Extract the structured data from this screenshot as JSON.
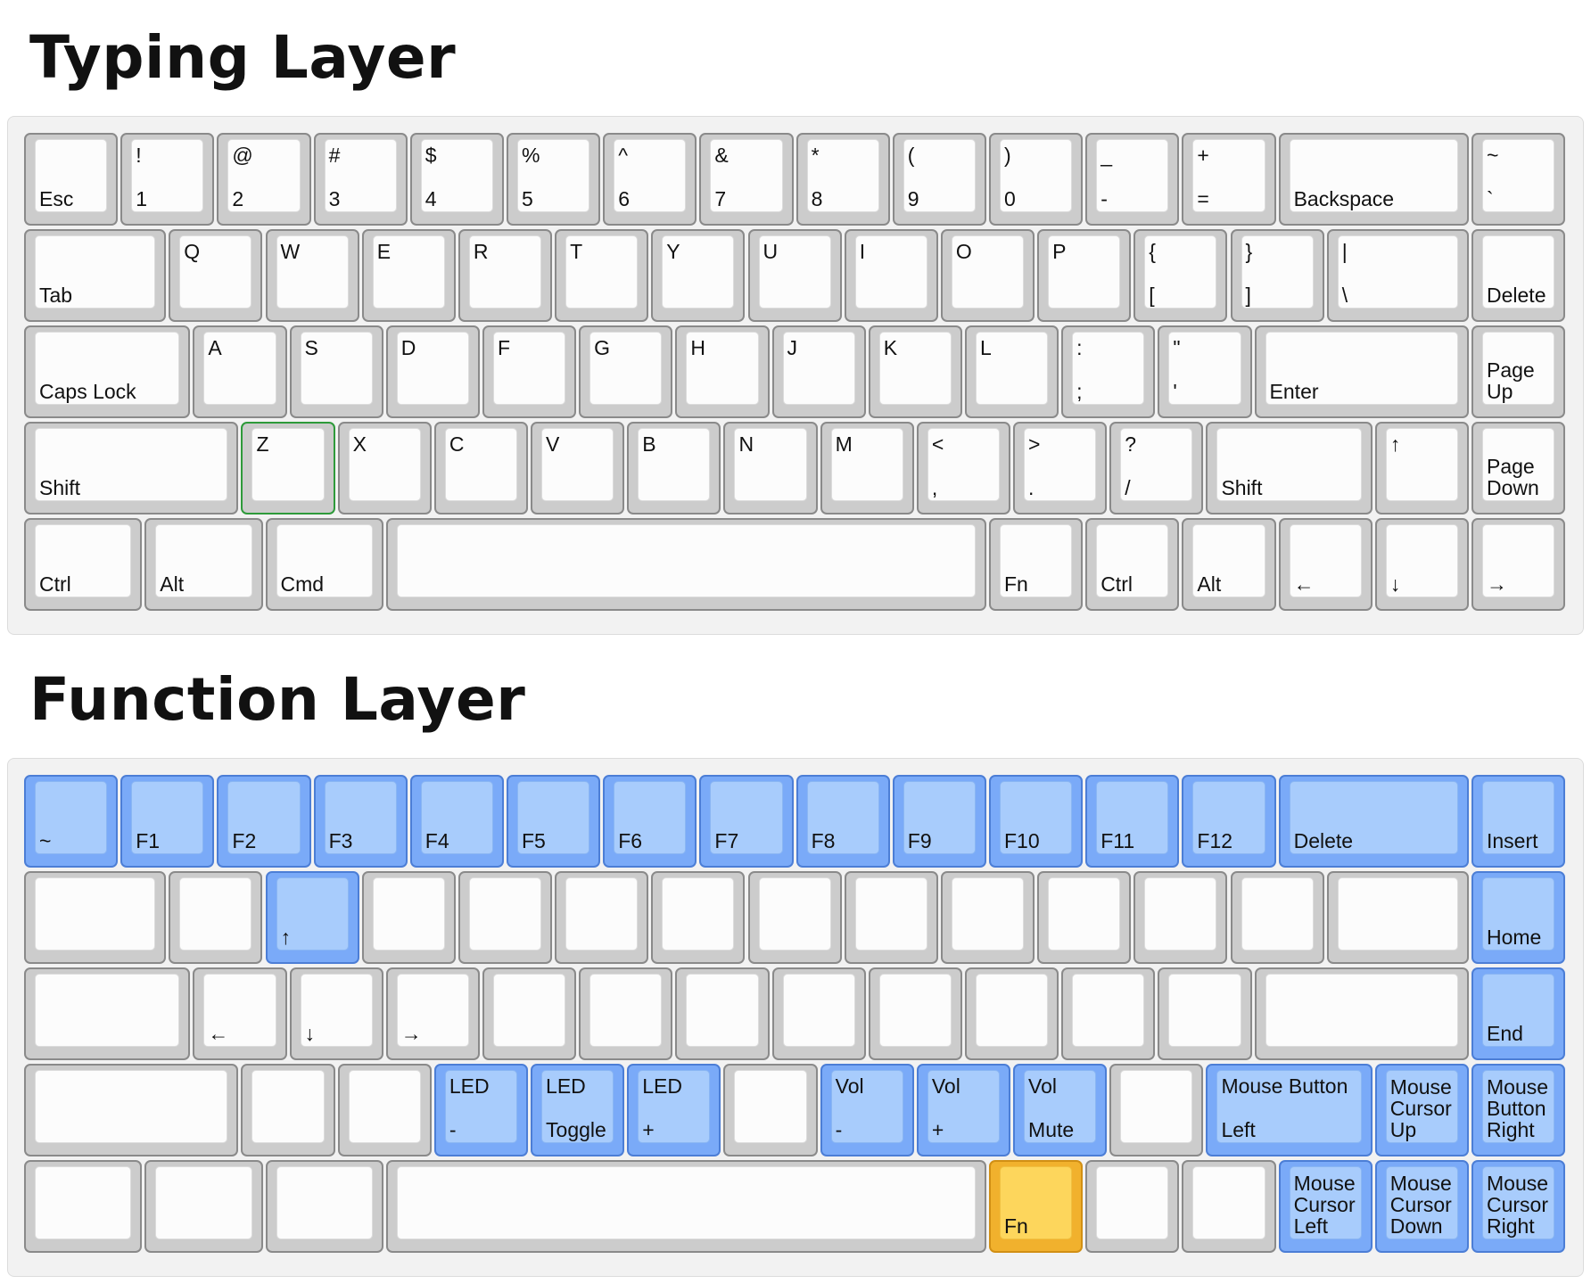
{
  "typing_layer": {
    "title": "Typing Layer",
    "rows": [
      [
        {
          "w": 1,
          "bottom": "Esc"
        },
        {
          "w": 1,
          "top": "!",
          "bottom": "1"
        },
        {
          "w": 1,
          "top": "@",
          "bottom": "2"
        },
        {
          "w": 1,
          "top": "#",
          "bottom": "3"
        },
        {
          "w": 1,
          "top": "$",
          "bottom": "4"
        },
        {
          "w": 1,
          "top": "%",
          "bottom": "5"
        },
        {
          "w": 1,
          "top": "^",
          "bottom": "6"
        },
        {
          "w": 1,
          "top": "&",
          "bottom": "7"
        },
        {
          "w": 1,
          "top": "*",
          "bottom": "8"
        },
        {
          "w": 1,
          "top": "(",
          "bottom": "9"
        },
        {
          "w": 1,
          "top": ")",
          "bottom": "0"
        },
        {
          "w": 1,
          "top": "_",
          "bottom": "-"
        },
        {
          "w": 1,
          "top": "+",
          "bottom": "="
        },
        {
          "w": 2,
          "bottom": "Backspace"
        },
        {
          "w": 1,
          "top": "~",
          "bottom": "`"
        }
      ],
      [
        {
          "w": 1.5,
          "bottom": "Tab"
        },
        {
          "w": 1,
          "top": "Q"
        },
        {
          "w": 1,
          "top": "W"
        },
        {
          "w": 1,
          "top": "E"
        },
        {
          "w": 1,
          "top": "R"
        },
        {
          "w": 1,
          "top": "T"
        },
        {
          "w": 1,
          "top": "Y"
        },
        {
          "w": 1,
          "top": "U"
        },
        {
          "w": 1,
          "top": "I"
        },
        {
          "w": 1,
          "top": "O"
        },
        {
          "w": 1,
          "top": "P"
        },
        {
          "w": 1,
          "top": "{",
          "bottom": "["
        },
        {
          "w": 1,
          "top": "}",
          "bottom": "]"
        },
        {
          "w": 1.5,
          "top": "|",
          "bottom": "\\"
        },
        {
          "w": 1,
          "bottom": "Delete"
        }
      ],
      [
        {
          "w": 1.75,
          "bottom": "Caps Lock"
        },
        {
          "w": 1,
          "top": "A"
        },
        {
          "w": 1,
          "top": "S"
        },
        {
          "w": 1,
          "top": "D"
        },
        {
          "w": 1,
          "top": "F"
        },
        {
          "w": 1,
          "top": "G"
        },
        {
          "w": 1,
          "top": "H"
        },
        {
          "w": 1,
          "top": "J"
        },
        {
          "w": 1,
          "top": "K"
        },
        {
          "w": 1,
          "top": "L"
        },
        {
          "w": 1,
          "top": ":",
          "bottom": ";"
        },
        {
          "w": 1,
          "top": "\"",
          "bottom": "'"
        },
        {
          "w": 2.25,
          "bottom": "Enter"
        },
        {
          "w": 1,
          "bottom": "Page\nUp"
        }
      ],
      [
        {
          "w": 2.25,
          "bottom": "Shift"
        },
        {
          "w": 1,
          "top": "Z",
          "highlight": "green"
        },
        {
          "w": 1,
          "top": "X"
        },
        {
          "w": 1,
          "top": "C"
        },
        {
          "w": 1,
          "top": "V"
        },
        {
          "w": 1,
          "top": "B"
        },
        {
          "w": 1,
          "top": "N"
        },
        {
          "w": 1,
          "top": "M"
        },
        {
          "w": 1,
          "top": "<",
          "bottom": ","
        },
        {
          "w": 1,
          "top": ">",
          "bottom": "."
        },
        {
          "w": 1,
          "top": "?",
          "bottom": "/"
        },
        {
          "w": 1.75,
          "bottom": "Shift"
        },
        {
          "w": 1,
          "top": "↑"
        },
        {
          "w": 1,
          "bottom": "Page\nDown"
        }
      ],
      [
        {
          "w": 1.25,
          "bottom": "Ctrl"
        },
        {
          "w": 1.25,
          "bottom": "Alt"
        },
        {
          "w": 1.25,
          "bottom": "Cmd"
        },
        {
          "w": 6.25,
          "bottom": ""
        },
        {
          "w": 1,
          "bottom": "Fn"
        },
        {
          "w": 1,
          "bottom": "Ctrl"
        },
        {
          "w": 1,
          "bottom": "Alt"
        },
        {
          "w": 1,
          "bottom": "←"
        },
        {
          "w": 1,
          "bottom": "↓"
        },
        {
          "w": 1,
          "bottom": "→"
        }
      ]
    ]
  },
  "function_layer": {
    "title": "Function Layer",
    "rows": [
      [
        {
          "w": 1,
          "bottom": "~",
          "highlight": "blue"
        },
        {
          "w": 1,
          "bottom": "F1",
          "highlight": "blue"
        },
        {
          "w": 1,
          "bottom": "F2",
          "highlight": "blue"
        },
        {
          "w": 1,
          "bottom": "F3",
          "highlight": "blue"
        },
        {
          "w": 1,
          "bottom": "F4",
          "highlight": "blue"
        },
        {
          "w": 1,
          "bottom": "F5",
          "highlight": "blue"
        },
        {
          "w": 1,
          "bottom": "F6",
          "highlight": "blue"
        },
        {
          "w": 1,
          "bottom": "F7",
          "highlight": "blue"
        },
        {
          "w": 1,
          "bottom": "F8",
          "highlight": "blue"
        },
        {
          "w": 1,
          "bottom": "F9",
          "highlight": "blue"
        },
        {
          "w": 1,
          "bottom": "F10",
          "highlight": "blue"
        },
        {
          "w": 1,
          "bottom": "F11",
          "highlight": "blue"
        },
        {
          "w": 1,
          "bottom": "F12",
          "highlight": "blue"
        },
        {
          "w": 2,
          "bottom": "Delete",
          "highlight": "blue"
        },
        {
          "w": 1,
          "bottom": "Insert",
          "highlight": "blue"
        }
      ],
      [
        {
          "w": 1.5
        },
        {
          "w": 1
        },
        {
          "w": 1,
          "bottom": "↑",
          "highlight": "blue"
        },
        {
          "w": 1
        },
        {
          "w": 1
        },
        {
          "w": 1
        },
        {
          "w": 1
        },
        {
          "w": 1
        },
        {
          "w": 1
        },
        {
          "w": 1
        },
        {
          "w": 1
        },
        {
          "w": 1
        },
        {
          "w": 1
        },
        {
          "w": 1.5
        },
        {
          "w": 1,
          "bottom": "Home",
          "highlight": "blue"
        }
      ],
      [
        {
          "w": 1.75
        },
        {
          "w": 1,
          "bottom": "←"
        },
        {
          "w": 1,
          "bottom": "↓"
        },
        {
          "w": 1,
          "bottom": "→"
        },
        {
          "w": 1
        },
        {
          "w": 1
        },
        {
          "w": 1
        },
        {
          "w": 1
        },
        {
          "w": 1
        },
        {
          "w": 1
        },
        {
          "w": 1
        },
        {
          "w": 1
        },
        {
          "w": 2.25
        },
        {
          "w": 1,
          "bottom": "End",
          "highlight": "blue"
        }
      ],
      [
        {
          "w": 2.25
        },
        {
          "w": 1
        },
        {
          "w": 1
        },
        {
          "w": 1,
          "top": "LED",
          "bottom": "-",
          "highlight": "blue"
        },
        {
          "w": 1,
          "top": "LED",
          "bottom": "Toggle",
          "highlight": "blue"
        },
        {
          "w": 1,
          "top": "LED",
          "bottom": "+",
          "highlight": "blue"
        },
        {
          "w": 1
        },
        {
          "w": 1,
          "top": "Vol",
          "bottom": "-",
          "highlight": "blue"
        },
        {
          "w": 1,
          "top": "Vol",
          "bottom": "+",
          "highlight": "blue"
        },
        {
          "w": 1,
          "top": "Vol",
          "bottom": "Mute",
          "highlight": "blue"
        },
        {
          "w": 1
        },
        {
          "w": 1.75,
          "top": "Mouse Button",
          "bottom": "Left",
          "highlight": "blue"
        },
        {
          "w": 1,
          "bottom": "Mouse\nCursor\nUp",
          "highlight": "blue"
        },
        {
          "w": 1,
          "bottom": "Mouse\nButton\nRight",
          "highlight": "blue"
        }
      ],
      [
        {
          "w": 1.25
        },
        {
          "w": 1.25
        },
        {
          "w": 1.25
        },
        {
          "w": 6.25
        },
        {
          "w": 1,
          "bottom": "Fn",
          "highlight": "orange"
        },
        {
          "w": 1
        },
        {
          "w": 1
        },
        {
          "w": 1,
          "bottom": "Mouse\nCursor\nLeft",
          "highlight": "blue"
        },
        {
          "w": 1,
          "bottom": "Mouse\nCursor\nDown",
          "highlight": "blue"
        },
        {
          "w": 1,
          "bottom": "Mouse\nCursor\nRight",
          "highlight": "blue"
        }
      ]
    ]
  }
}
